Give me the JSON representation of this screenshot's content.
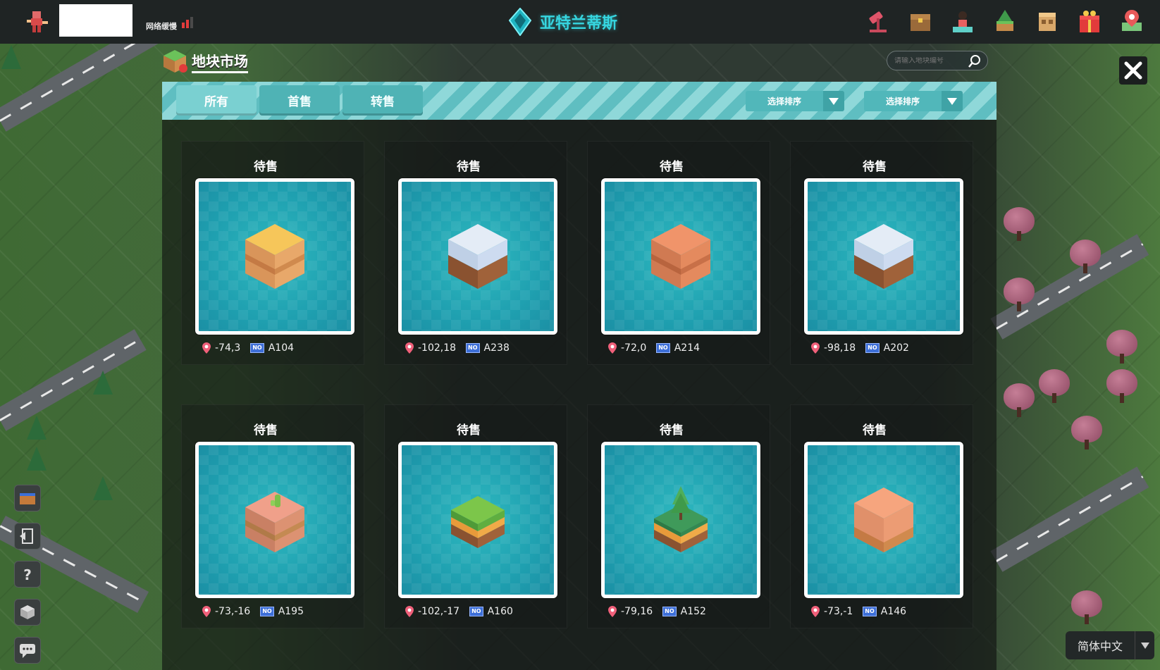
{
  "header": {
    "network_status": "网络缓慢",
    "world_title": "亚特兰蒂斯",
    "icons": [
      "hammer-icon",
      "treasure-chest-icon",
      "character-icon",
      "land-tree-icon",
      "building-icon",
      "gift-icon",
      "map-pin-icon"
    ]
  },
  "market": {
    "title": "地块市场",
    "search_placeholder": "请输入地块编号",
    "tabs": [
      {
        "label": "所有",
        "active": true
      },
      {
        "label": "首售",
        "active": false
      },
      {
        "label": "转售",
        "active": false
      }
    ],
    "sort1_label": "选择排序",
    "sort2_label": "选择排序",
    "colors": {
      "accent": "#36d6e0",
      "tile": "#1fa0b0",
      "tab": "#4fb3b5"
    },
    "items": [
      {
        "status": "待售",
        "coords": "-74,3",
        "id": "A104",
        "block": "sand"
      },
      {
        "status": "待售",
        "coords": "-102,18",
        "id": "A238",
        "block": "snow"
      },
      {
        "status": "待售",
        "coords": "-72,0",
        "id": "A214",
        "block": "clay"
      },
      {
        "status": "待售",
        "coords": "-98,18",
        "id": "A202",
        "block": "snow"
      },
      {
        "status": "待售",
        "coords": "-73,-16",
        "id": "A195",
        "block": "clay-cactus"
      },
      {
        "status": "待售",
        "coords": "-102,-17",
        "id": "A160",
        "block": "grass"
      },
      {
        "status": "待售",
        "coords": "-79,16",
        "id": "A152",
        "block": "grass-tree"
      },
      {
        "status": "待售",
        "coords": "-73,-1",
        "id": "A146",
        "block": "peach"
      }
    ]
  },
  "footer": {
    "language": "简体中文"
  }
}
